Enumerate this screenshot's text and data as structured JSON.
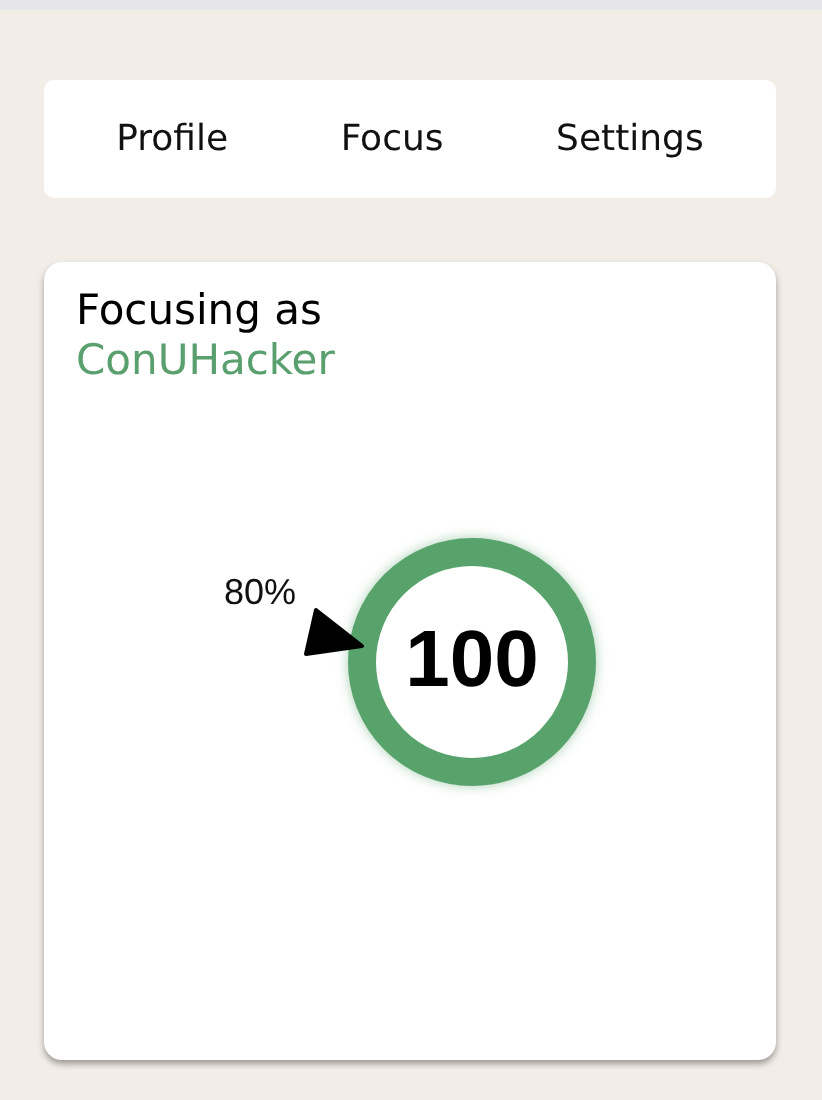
{
  "nav": [
    {
      "label": "Profile"
    },
    {
      "label": "Focus"
    },
    {
      "label": "Settings"
    }
  ],
  "focus": {
    "title": "Focusing as",
    "username": "ConUHacker",
    "gauge": {
      "percent_label": "80%",
      "score": "100"
    }
  }
}
